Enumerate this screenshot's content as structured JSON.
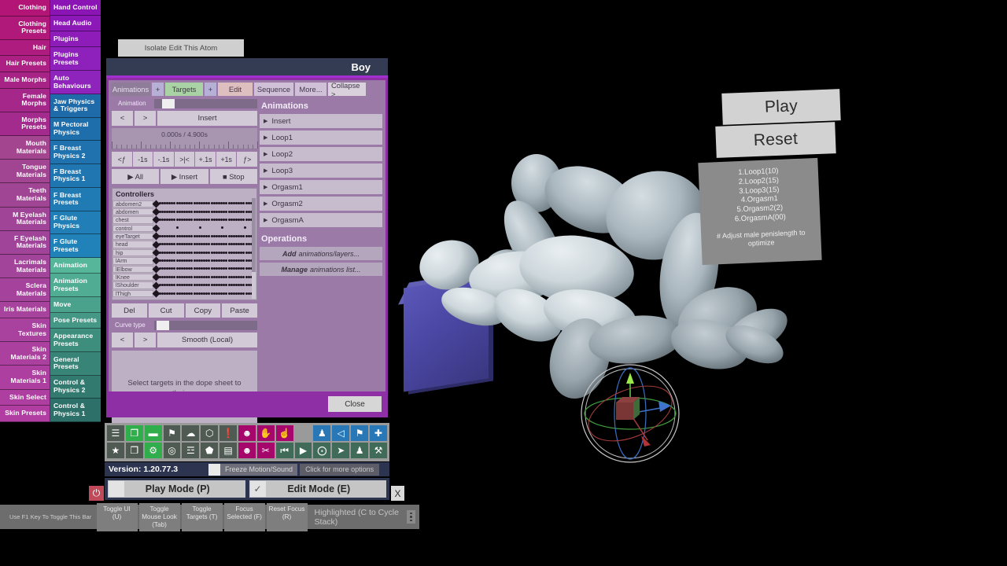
{
  "viewport": {
    "gizmo_axes": [
      "x-axis-red",
      "y-axis-green",
      "z-axis-blue"
    ]
  },
  "hud": {
    "play_label": "Play",
    "reset_label": "Reset",
    "info_lines": [
      "1.Loop1(10)",
      "2.Loop2(15)",
      "3.Loop3(15)",
      "4.Orgasm1",
      "5.Orgasm2(2)",
      "6.OrgasmA(00)"
    ],
    "info_note": "# Adjust male penislength to optimize"
  },
  "sidebar": {
    "left_items": [
      {
        "label": "Clothing",
        "color": "#b21576"
      },
      {
        "label": "Clothing Presets",
        "color": "#b0197a"
      },
      {
        "label": "Hair",
        "color": "#ad1c7e"
      },
      {
        "label": "Hair Presets",
        "color": "#ab2082"
      },
      {
        "label": "Male Morphs",
        "color": "#a82386"
      },
      {
        "label": "Female Morphs",
        "color": "#a6278a"
      },
      {
        "label": "Morphs Presets",
        "color": "#a32b8e"
      },
      {
        "label": "Mouth Materials",
        "color": "#a3458f"
      },
      {
        "label": "Tongue Materials",
        "color": "#a14491"
      },
      {
        "label": "Teeth Materials",
        "color": "#a04494"
      },
      {
        "label": "M Eyelash Materials",
        "color": "#a04497"
      },
      {
        "label": "F Eyelash Materials",
        "color": "#a0449a"
      },
      {
        "label": "Lacrimals Materials",
        "color": "#a3449b"
      },
      {
        "label": "Sclera Materials",
        "color": "#a5439c"
      },
      {
        "label": "Iris Materials",
        "color": "#a7429d"
      },
      {
        "label": "Skin Textures",
        "color": "#a9419e"
      },
      {
        "label": "Skin Materials 2",
        "color": "#ab409f"
      },
      {
        "label": "Skin Materials 1",
        "color": "#ad3fa0"
      },
      {
        "label": "Skin Select",
        "color": "#af3ea1"
      },
      {
        "label": "Skin Presets",
        "color": "#b13da2"
      }
    ],
    "right_items": [
      {
        "label": "Hand Control",
        "color": "#8b14b5"
      },
      {
        "label": "Head Audio",
        "color": "#8c18b7"
      },
      {
        "label": "Plugins",
        "color": "#8d1cb9"
      },
      {
        "label": "Plugins Presets",
        "color": "#8e20bb"
      },
      {
        "label": "Auto Behaviours",
        "color": "#8f24bd"
      },
      {
        "label": "Jaw Physics & Triggers",
        "color": "#1f6aa8"
      },
      {
        "label": "M Pectoral Physics",
        "color": "#1f6eac"
      },
      {
        "label": "F Breast Physics 2",
        "color": "#2072ae"
      },
      {
        "label": "F Breast Physics 1",
        "color": "#2076b0"
      },
      {
        "label": "F Breast Presets",
        "color": "#207ab3"
      },
      {
        "label": "F Glute Physics",
        "color": "#217eb6"
      },
      {
        "label": "F Glute Presets",
        "color": "#2182b9"
      },
      {
        "label": "Animation",
        "color": "#56b69a"
      },
      {
        "label": "Animation Presets",
        "color": "#50ac93"
      },
      {
        "label": "Move",
        "color": "#4aa28c"
      },
      {
        "label": "Pose Presets",
        "color": "#449885"
      },
      {
        "label": "Appearance Presets",
        "color": "#3e8e7e"
      },
      {
        "label": "General Presets",
        "color": "#388477"
      },
      {
        "label": "Control & Physics 2",
        "color": "#327a70"
      },
      {
        "label": "Control & Physics 1",
        "color": "#2c7069"
      }
    ]
  },
  "isolate_button": {
    "label": "Isolate Edit This Atom"
  },
  "dialog": {
    "title": "Boy",
    "close_label": "Close",
    "tabs": [
      {
        "label": "Animations",
        "style": "sel"
      },
      {
        "label": "+",
        "style": "plus"
      },
      {
        "label": "Targets",
        "style": "green"
      },
      {
        "label": "+",
        "style": "plus"
      },
      {
        "label": "Edit",
        "style": "pink"
      },
      {
        "label": "Sequence",
        "style": "lav"
      },
      {
        "label": "More...",
        "style": "lav"
      },
      {
        "label": "Collapse >",
        "style": "pale"
      }
    ],
    "animation_slider_label": "Animation",
    "prev_label": "<",
    "next_label": ">",
    "current_animation": "Insert",
    "time_readout": "0.000s / 4.900s",
    "nav_buttons": [
      "<ƒ",
      "-1s",
      "-.1s",
      ">|<",
      "+.1s",
      "+1s",
      "ƒ>"
    ],
    "play_buttons": [
      "▶ All",
      "▶ Insert",
      "■ Stop"
    ],
    "controllers_header": "Controllers",
    "controllers": [
      "abdomen2",
      "abdomen",
      "chest",
      "control",
      "eyeTarget",
      "head",
      "hip",
      "lArm",
      "lElbow",
      "lKnee",
      "lShoulder",
      "lThigh"
    ],
    "edit_buttons": [
      "Del",
      "Cut",
      "Copy",
      "Paste"
    ],
    "curve_type_label": "Curve type",
    "curve_prev": "<",
    "curve_next": ">",
    "curve_value": "Smooth (Local)",
    "curve_message": "Select targets in the dope sheet to see their curves",
    "animations_section_title": "Animations",
    "animations_list": [
      "Insert",
      "Loop1",
      "Loop2",
      "Loop3",
      "Orgasm1",
      "Orgasm2",
      "OrgasmA"
    ],
    "operations_section_title": "Operations",
    "operations": [
      {
        "bold": "Add",
        "rest": "animations/layers..."
      },
      {
        "bold": "Manage",
        "rest": "animations list..."
      }
    ]
  },
  "toolbar": {
    "row1": [
      {
        "name": "menu-icon",
        "glyph": "☰",
        "color": "gray"
      },
      {
        "name": "open-scene-icon",
        "glyph": "❐",
        "color": "green"
      },
      {
        "name": "folder-icon",
        "glyph": "▬",
        "color": "green"
      },
      {
        "name": "save-scene-icon",
        "glyph": "⚑",
        "color": "gray"
      },
      {
        "name": "cloud-download-icon",
        "glyph": "☁",
        "color": "gray"
      },
      {
        "name": "package-icon",
        "glyph": "⬡",
        "color": "gray"
      },
      {
        "name": "alert-icon",
        "glyph": "❗",
        "color": "gray"
      },
      {
        "name": "add-person-icon",
        "glyph": "☻",
        "color": "mag"
      },
      {
        "name": "hand-open-icon",
        "glyph": "✋",
        "color": "mag"
      },
      {
        "name": "hand-point-icon",
        "glyph": "☝",
        "color": "mag"
      },
      {
        "name": "spacer",
        "glyph": "",
        "color": "none"
      },
      {
        "name": "person-icon",
        "glyph": "♟",
        "color": "blue"
      },
      {
        "name": "unity-icon",
        "glyph": "◁",
        "color": "blue"
      },
      {
        "name": "flag-icon",
        "glyph": "⚑",
        "color": "blue"
      },
      {
        "name": "plus-icon",
        "glyph": "✚",
        "color": "blue"
      }
    ],
    "row2": [
      {
        "name": "star-icon",
        "glyph": "★",
        "color": "gray"
      },
      {
        "name": "save-as-icon",
        "glyph": "❐",
        "color": "gray"
      },
      {
        "name": "folder-settings-icon",
        "glyph": "⚙",
        "color": "green"
      },
      {
        "name": "camera-icon",
        "glyph": "◎",
        "color": "gray"
      },
      {
        "name": "share-icon",
        "glyph": "☲",
        "color": "gray"
      },
      {
        "name": "shield-icon",
        "glyph": "⬟",
        "color": "gray"
      },
      {
        "name": "clipboard-icon",
        "glyph": "▤",
        "color": "gray"
      },
      {
        "name": "remove-person-icon",
        "glyph": "☻",
        "color": "mag"
      },
      {
        "name": "wrench-icon",
        "glyph": "✂",
        "color": "mag"
      },
      {
        "name": "skip-back-icon",
        "glyph": "⏮",
        "color": "teal"
      },
      {
        "name": "play-icon",
        "glyph": "▶",
        "color": "teal"
      },
      {
        "name": "target-icon",
        "glyph": "⨀",
        "color": "teal"
      },
      {
        "name": "cursor-icon",
        "glyph": "➤",
        "color": "teal"
      },
      {
        "name": "group-icon",
        "glyph": "♟",
        "color": "teal"
      },
      {
        "name": "tools-icon",
        "glyph": "⚒",
        "color": "teal"
      }
    ]
  },
  "status": {
    "version": "Version: 1.20.77.3",
    "freeze_label": "Freeze Motion/Sound",
    "freeze_checked": false,
    "more_options": "Click for more options",
    "play_mode_label": "Play Mode (P)",
    "play_mode_checked": false,
    "edit_mode_label": "Edit Mode (E)",
    "edit_mode_checked": true,
    "edit_mode_check_glyph": "✓",
    "power_glyph": "⏻",
    "close_x": "X"
  },
  "helpbar": {
    "note": "Use F1 Key To Toggle This Bar",
    "buttons": [
      "Toggle UI (U)",
      "Toggle Mouse Look (Tab)",
      "Toggle Targets (T)",
      "Focus Selected (F)",
      "Reset Focus (R)"
    ],
    "highlight": "Highlighted (C to Cycle Stack)"
  }
}
